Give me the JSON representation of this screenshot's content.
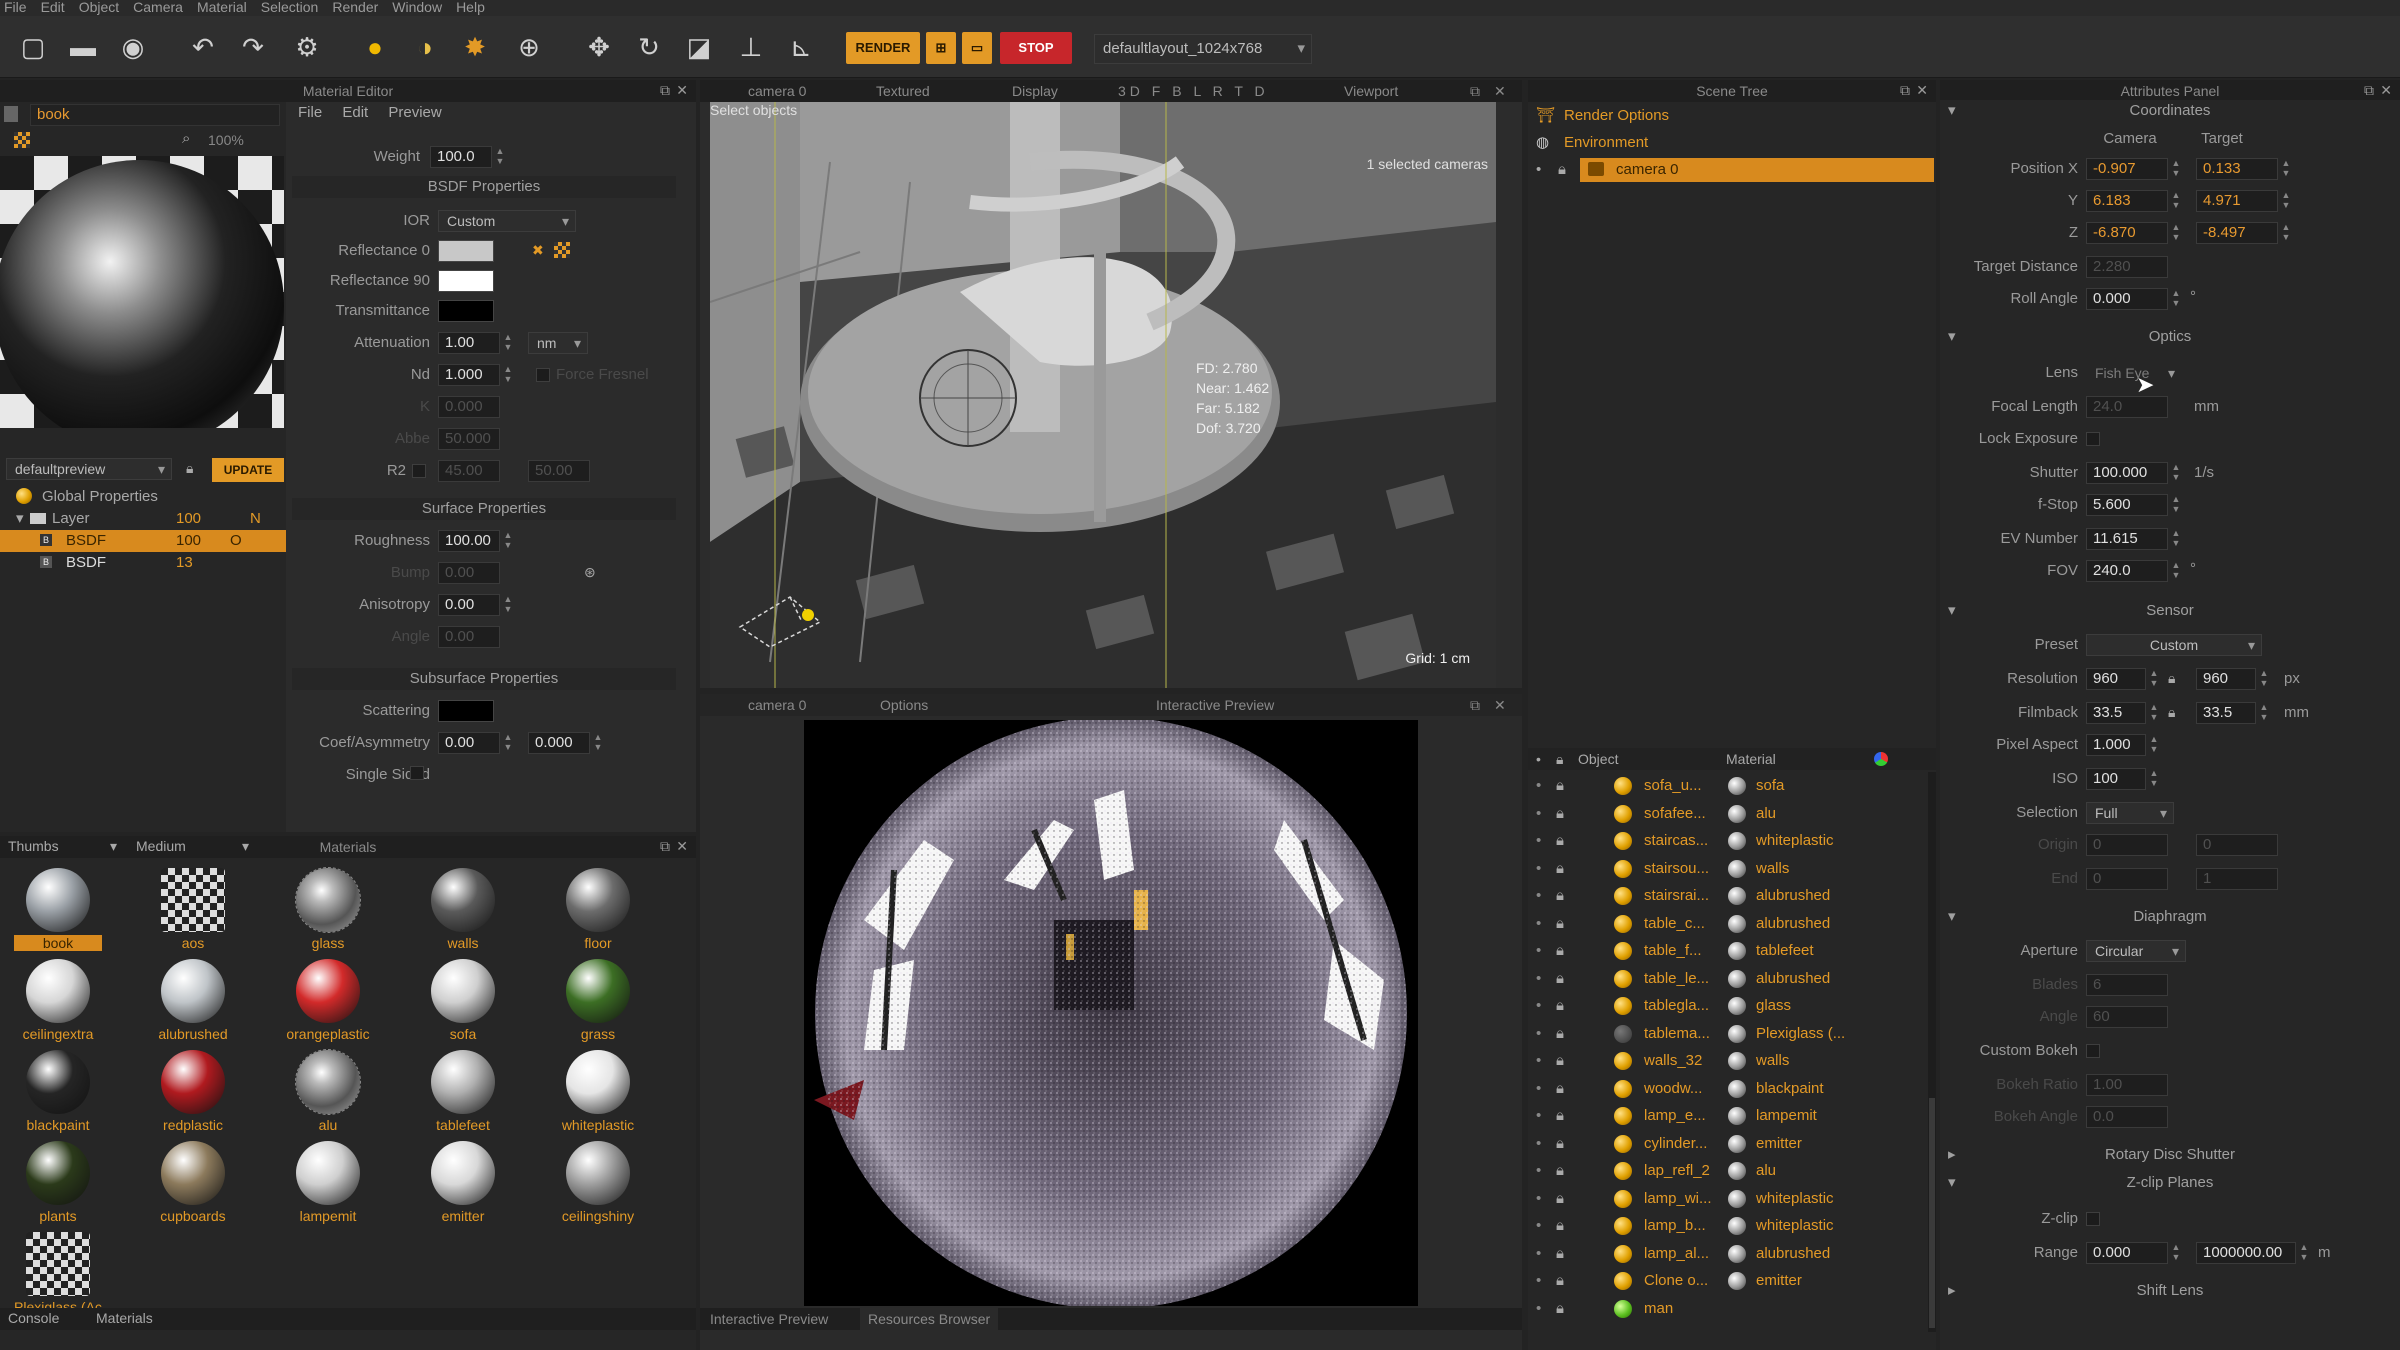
{
  "menu": [
    "File",
    "Edit",
    "Object",
    "Camera",
    "Material",
    "Selection",
    "Render",
    "Window",
    "Help"
  ],
  "toolbar": {
    "render_label": "RENDER",
    "stop_label": "STOP",
    "layout": "defaultlayout_1024x768"
  },
  "material_editor": {
    "title": "Material Editor",
    "name_field": "book",
    "zoom": "100%",
    "menu": [
      "File",
      "Edit",
      "Preview"
    ],
    "preview_select": "defaultpreview",
    "update_label": "UPDATE",
    "tree": [
      {
        "label": "Global Properties",
        "v1": "",
        "v2": ""
      },
      {
        "label": "Layer",
        "v1": "100",
        "v2": "N"
      },
      {
        "label": "BSDF",
        "v1": "100",
        "v2": "O"
      },
      {
        "label": "BSDF",
        "v1": "13",
        "v2": ""
      }
    ],
    "weight_label": "Weight",
    "weight": "100.0",
    "bsdf_title": "BSDF Properties",
    "ior_label": "IOR",
    "ior": "Custom",
    "refl0_label": "Reflectance 0",
    "refl90_label": "Reflectance 90",
    "trans_label": "Transmittance",
    "atten_label": "Attenuation",
    "atten": "1.00",
    "atten_unit": "nm",
    "nd_label": "Nd",
    "nd": "1.000",
    "force_label": "Force Fresnel",
    "k_label": "K",
    "k": "0.000",
    "abbe_label": "Abbe",
    "abbe": "50.000",
    "r2_label": "R2",
    "r2a": "45.00",
    "r2b": "50.00",
    "surface_title": "Surface Properties",
    "rough_label": "Roughness",
    "rough": "100.00",
    "bump_label": "Bump",
    "bump": "0.00",
    "aniso_label": "Anisotropy",
    "aniso": "0.00",
    "angle_label": "Angle",
    "angle": "0.00",
    "subsurface_title": "Subsurface Properties",
    "scatter_label": "Scattering",
    "coef_label": "Coef/Asymmetry",
    "coef1": "0.00",
    "coef2": "0.000",
    "single_label": "Single Sided"
  },
  "materials_panel": {
    "title": "Materials",
    "view": "Thumbs",
    "size": "Medium",
    "items": [
      {
        "name": "book",
        "color": "#9aa0a6"
      },
      {
        "name": "aos",
        "color": "checker"
      },
      {
        "name": "glass",
        "color": "glass"
      },
      {
        "name": "walls",
        "color": "#5a5a5a"
      },
      {
        "name": "floor",
        "color": "#6c6c6c"
      },
      {
        "name": "ceilingextra",
        "color": "#d6d6d6"
      },
      {
        "name": "alubrushed",
        "color": "#bfc4c8"
      },
      {
        "name": "orangeplastic",
        "color": "#d22a2a"
      },
      {
        "name": "sofa",
        "color": "#cfcfcf"
      },
      {
        "name": "grass",
        "color": "#3c6e24"
      },
      {
        "name": "blackpaint",
        "color": "#252525"
      },
      {
        "name": "redplastic",
        "color": "#b01a1f"
      },
      {
        "name": "alu",
        "color": "glass"
      },
      {
        "name": "tablefeet",
        "color": "#b0b0b0"
      },
      {
        "name": "whiteplastic",
        "color": "#e5e5e5"
      },
      {
        "name": "plants",
        "color": "#2b3a1a"
      },
      {
        "name": "cupboards",
        "color": "#8c7a5c"
      },
      {
        "name": "lampemit",
        "color": "#cfcfcf"
      },
      {
        "name": "emitter",
        "color": "#d8d8d8"
      },
      {
        "name": "ceilingshiny",
        "color": "#9e9e9e"
      },
      {
        "name": "Plexiglass (Acrylic)",
        "color": "checker"
      }
    ],
    "tabs": [
      "Console",
      "Materials"
    ]
  },
  "viewport": {
    "title": "Viewport",
    "camera": "camera 0",
    "shading": "Textured",
    "display": "Display",
    "views": [
      "3D",
      "F",
      "B",
      "L",
      "R",
      "T",
      "D"
    ],
    "status": "Select objects",
    "selected": "1 selected cameras",
    "info": [
      "FD: 2.780",
      "Near: 1.462",
      "Far: 5.182",
      "Dof: 3.720"
    ],
    "grid": "Grid: 1 cm"
  },
  "preview": {
    "title": "Interactive Preview",
    "camera": "camera 0",
    "options": "Options",
    "tabs": [
      "Interactive Preview",
      "Resources Browser"
    ]
  },
  "scene_tree": {
    "title": "Scene Tree",
    "top": [
      "Render Options",
      "Environment",
      "camera 0"
    ],
    "col_object": "Object",
    "col_material": "Material",
    "objects": [
      {
        "obj": "sofa_u...",
        "mat": "sofa"
      },
      {
        "obj": "sofafee...",
        "mat": "alu"
      },
      {
        "obj": "staircas...",
        "mat": "whiteplastic"
      },
      {
        "obj": "stairsou...",
        "mat": "walls"
      },
      {
        "obj": "stairsrai...",
        "mat": "alubrushed"
      },
      {
        "obj": "table_c...",
        "mat": "alubrushed"
      },
      {
        "obj": "table_f...",
        "mat": "tablefeet"
      },
      {
        "obj": "table_le...",
        "mat": "alubrushed"
      },
      {
        "obj": "tablegla...",
        "mat": "glass"
      },
      {
        "obj": "tablema...",
        "mat": "Plexiglass (..."
      },
      {
        "obj": "walls_32",
        "mat": "walls"
      },
      {
        "obj": "woodw...",
        "mat": "blackpaint"
      },
      {
        "obj": "lamp_e...",
        "mat": "lampemit"
      },
      {
        "obj": "cylinder...",
        "mat": "emitter"
      },
      {
        "obj": "lap_refl_2",
        "mat": "alu"
      },
      {
        "obj": "lamp_wi...",
        "mat": "whiteplastic"
      },
      {
        "obj": "lamp_b...",
        "mat": "whiteplastic"
      },
      {
        "obj": "lamp_al...",
        "mat": "alubrushed"
      },
      {
        "obj": "Clone o...",
        "mat": "emitter"
      },
      {
        "obj": "man",
        "mat": ""
      }
    ]
  },
  "attributes": {
    "title": "Attributes Panel",
    "coords_title": "Coordinates",
    "col_camera": "Camera",
    "col_target": "Target",
    "posx_label": "Position X",
    "posx": "-0.907",
    "tx": "0.133",
    "y_label": "Y",
    "posy": "6.183",
    "ty": "4.971",
    "z_label": "Z",
    "posz": "-6.870",
    "tz": "-8.497",
    "tdist_label": "Target Distance",
    "tdist": "2.280",
    "roll_label": "Roll Angle",
    "roll": "0.000",
    "deg": "°",
    "optics_title": "Optics",
    "lens_label": "Lens",
    "lens": "Fish Eye",
    "focal_label": "Focal Length",
    "focal": "24.0",
    "focal_unit": "mm",
    "lock_label": "Lock Exposure",
    "shutter_label": "Shutter",
    "shutter": "100.000",
    "shutter_unit": "1/s",
    "fstop_label": "f-Stop",
    "fstop": "5.600",
    "ev_label": "EV Number",
    "ev": "11.615",
    "fov_label": "FOV",
    "fov": "240.0",
    "sensor_title": "Sensor",
    "preset_label": "Preset",
    "preset": "Custom",
    "res_label": "Resolution",
    "res_w": "960",
    "res_h": "960",
    "res_unit": "px",
    "film_label": "Filmback",
    "film_w": "33.5",
    "film_h": "33.5",
    "film_unit": "mm",
    "pa_label": "Pixel Aspect",
    "pa": "1.000",
    "iso_label": "ISO",
    "iso": "100",
    "sel_label": "Selection",
    "sel": "Full",
    "origin_label": "Origin",
    "origin1": "0",
    "origin2": "0",
    "end_label": "End",
    "end1": "0",
    "end2": "1",
    "diaphragm_title": "Diaphragm",
    "aperture_label": "Aperture",
    "aperture": "Circular",
    "blades_label": "Blades",
    "blades": "6",
    "dangle_label": "Angle",
    "dangle": "60",
    "bokeh_label": "Custom Bokeh",
    "bokeh_ratio_label": "Bokeh Ratio",
    "bokeh_ratio": "1.00",
    "bokeh_angle_label": "Bokeh Angle",
    "bokeh_angle": "0.0",
    "rotary_title": "Rotary Disc Shutter",
    "zclip_title": "Z-clip Planes",
    "zclip_label": "Z-clip",
    "range_label": "Range",
    "range1": "0.000",
    "range2": "1000000.00",
    "range_unit": "m",
    "shift_title": "Shift Lens"
  },
  "colors": {
    "accent": "#e39a26",
    "stop": "#c7262b",
    "selection": "#d88a1e"
  }
}
